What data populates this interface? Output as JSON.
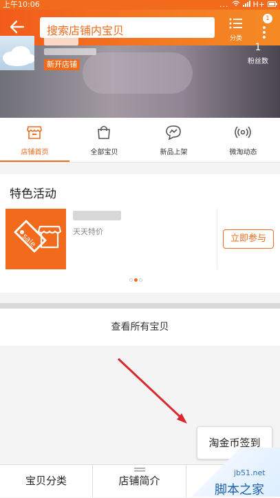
{
  "status_bar": {
    "time": "上午10:06",
    "signal": "...",
    "network": "H+"
  },
  "header": {
    "search_placeholder": "搜索店铺内宝贝",
    "category_label": "分类",
    "more_badge": "1",
    "icons": [
      "arrow-left-icon",
      "list-icon",
      "more-vertical-icon"
    ]
  },
  "shop": {
    "new_tag": "新开店铺",
    "fans_count": "1",
    "fans_label": "粉丝数"
  },
  "nav_tabs": [
    {
      "label": "店铺首页",
      "icon": "store-icon",
      "active": true
    },
    {
      "label": "全部宝贝",
      "icon": "bag-icon",
      "active": false
    },
    {
      "label": "新品上架",
      "icon": "chat-icon",
      "active": false
    },
    {
      "label": "微淘动态",
      "icon": "broadcast-icon",
      "active": false
    }
  ],
  "activity": {
    "title": "特色活动",
    "subtitle": "天天特价",
    "image_icon": "sale-tag-icon",
    "join_label": "立即参与"
  },
  "view_all_label": "查看所有宝贝",
  "sign_in_label": "淘金币签到",
  "bottom_bar": {
    "items": [
      {
        "label": "宝贝分类"
      },
      {
        "label": "店铺简介"
      }
    ]
  },
  "watermark": {
    "url": "jb51.net",
    "name": "脚本之家"
  },
  "colors": {
    "accent": "#f26a1b",
    "annotation_arrow": "#d9282f"
  }
}
